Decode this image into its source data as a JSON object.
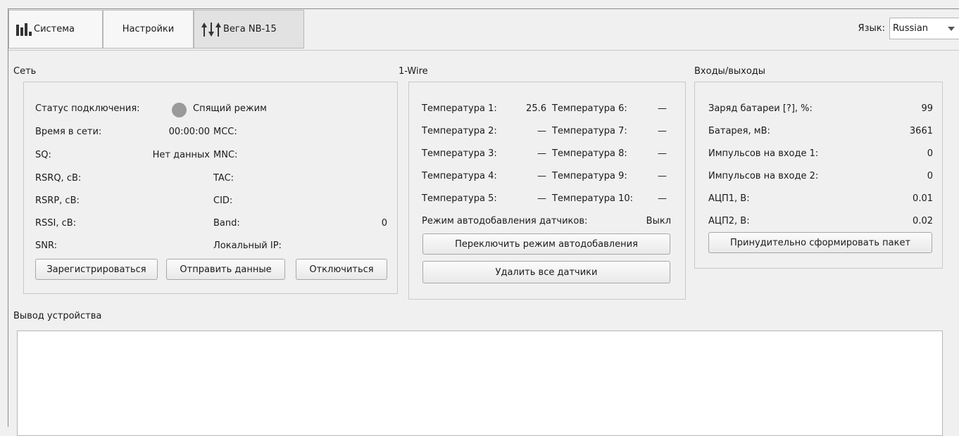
{
  "tabs": [
    {
      "label": "Система",
      "icon": "bar-chart-icon"
    },
    {
      "label": "Настройки"
    },
    {
      "label": "Вега NB-15",
      "icon": "arrows-icon"
    }
  ],
  "language": {
    "label": "Язык:",
    "value": "Russian"
  },
  "network": {
    "title": "Сеть",
    "status_label": "Статус подключения:",
    "status_value": "Спящий режим",
    "status_color": "#9a9a9a",
    "rows_left": [
      {
        "label": "Время в сети:",
        "value": "00:00:00"
      },
      {
        "label": "SQ:",
        "value": "Нет данных"
      },
      {
        "label": "RSRQ, cB:",
        "value": ""
      },
      {
        "label": "RSRP, cB:",
        "value": ""
      },
      {
        "label": "RSSI, cB:",
        "value": ""
      },
      {
        "label": "SNR:",
        "value": ""
      }
    ],
    "rows_right": [
      {
        "label": "MCC:",
        "value": ""
      },
      {
        "label": "MNC:",
        "value": ""
      },
      {
        "label": "TAC:",
        "value": ""
      },
      {
        "label": "CID:",
        "value": ""
      },
      {
        "label": "Band:",
        "value": "0"
      },
      {
        "label": "Локальный IP:",
        "value": ""
      }
    ],
    "buttons": {
      "register": "Зарегистрироваться",
      "send": "Отправить данные",
      "disconnect": "Отключиться"
    }
  },
  "onewire": {
    "title": "1-Wire",
    "temps_left": [
      {
        "label": "Температура 1:",
        "value": "25.6"
      },
      {
        "label": "Температура 2:",
        "value": "—"
      },
      {
        "label": "Температура 3:",
        "value": "—"
      },
      {
        "label": "Температура 4:",
        "value": "—"
      },
      {
        "label": "Температура 5:",
        "value": "—"
      }
    ],
    "temps_right": [
      {
        "label": "Температура 6:",
        "value": "—"
      },
      {
        "label": "Температура 7:",
        "value": "—"
      },
      {
        "label": "Температура 8:",
        "value": "—"
      },
      {
        "label": "Температура 9:",
        "value": "—"
      },
      {
        "label": "Температура 10:",
        "value": "—"
      }
    ],
    "autoadd_label": "Режим автодобавления датчиков:",
    "autoadd_value": "Выкл",
    "buttons": {
      "toggle": "Переключить режим автодобавления",
      "delete_all": "Удалить все датчики"
    }
  },
  "io": {
    "title": "Входы/выходы",
    "rows": [
      {
        "label": "Заряд батареи [?], %:",
        "value": "99"
      },
      {
        "label": "Батарея, мВ:",
        "value": "3661"
      },
      {
        "label": "Импульсов на входе 1:",
        "value": "0"
      },
      {
        "label": "Импульсов на входе 2:",
        "value": "0"
      },
      {
        "label": "АЦП1, В:",
        "value": "0.01"
      },
      {
        "label": "АЦП2, В:",
        "value": "0.02"
      }
    ],
    "button": "Принудительно сформировать пакет"
  },
  "output": {
    "title": "Вывод устройства",
    "text": ""
  }
}
